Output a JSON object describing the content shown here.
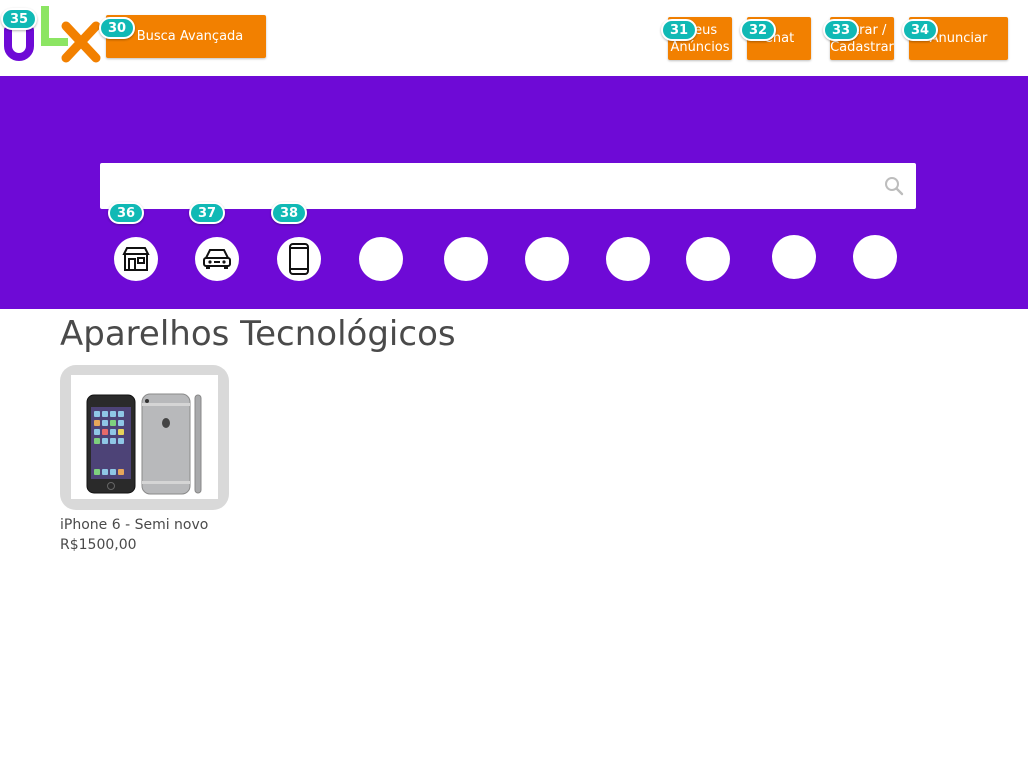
{
  "header": {
    "advanced_search_label": "Busca Avançada",
    "my_ads_label": "Meus\nAnúncios",
    "chat_label": "Chat",
    "login_label": "Entrar /\nCadastrar",
    "post_ad_label": "Anunciar"
  },
  "logo": {
    "letters": [
      "O",
      "L",
      "X"
    ]
  },
  "search": {
    "placeholder": "",
    "value": ""
  },
  "categories": [
    {
      "icon": "real-estate-icon"
    },
    {
      "icon": "car-icon"
    },
    {
      "icon": "phone-icon"
    },
    {
      "icon": ""
    },
    {
      "icon": ""
    },
    {
      "icon": ""
    },
    {
      "icon": ""
    },
    {
      "icon": ""
    },
    {
      "icon": ""
    },
    {
      "icon": ""
    }
  ],
  "section": {
    "title": "Aparelhos Tecnológicos"
  },
  "listings": [
    {
      "title": "iPhone 6 - Semi novo",
      "price": "R$1500,00",
      "image": "iphone-6-photo"
    }
  ],
  "badges": {
    "advanced_search": "30",
    "my_ads": "31",
    "chat": "32",
    "login": "33",
    "post_ad": "34",
    "logo": "35",
    "cat_real_estate": "36",
    "cat_cars": "37",
    "cat_phones": "38"
  },
  "colors": {
    "purple": "#6e0ad6",
    "orange": "#f28000",
    "green": "#8ce563",
    "badge_teal": "#10b9b5"
  }
}
